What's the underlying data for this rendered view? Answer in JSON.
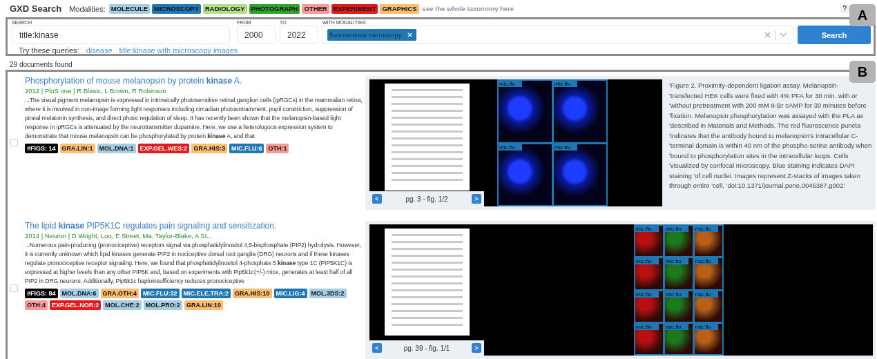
{
  "header": {
    "title": "GXD Search",
    "modalities_label": "Modalities:",
    "modalities": [
      {
        "label": "MOLECULE",
        "color": "#a6cee3"
      },
      {
        "label": "MICROSCOPY",
        "color": "#1f78b4"
      },
      {
        "label": "RADIOLOGY",
        "color": "#b2df8a"
      },
      {
        "label": "PHOTOGRAPH",
        "color": "#33a02c"
      },
      {
        "label": "OTHER",
        "color": "#fb9a99"
      },
      {
        "label": "EXPERIMENT",
        "color": "#e31a1c"
      },
      {
        "label": "GRAPHICS",
        "color": "#fdbf6f"
      }
    ],
    "taxonomy_link": "see the whole taxonomy here",
    "help": "?"
  },
  "search": {
    "search_label": "SEARCH",
    "query": "title:kinase",
    "from_label": "FROM",
    "from": "2000",
    "to_label": "TO",
    "to": "2022",
    "modalities_label": "WITH MODALITIES:",
    "chips": [
      {
        "label": "fluorescence microscopy",
        "color": "#1f78b4"
      }
    ],
    "button": "Search",
    "try_label": "Try these queries:",
    "suggestions": [
      "disease",
      "title:kinase with microscopy images"
    ]
  },
  "callouts": [
    "A",
    "B"
  ],
  "result_count": "29 documents found",
  "results": [
    {
      "title": "Phosphorylation of mouse melanopsin by protein **kinase** A.",
      "meta": "2012 | PloS one | R Blasic, L Brown, R Robinson",
      "checked": false,
      "abstract": "...The visual pigment melanopsin is expressed in intrinsically photosensitive retinal ganglion cells (ipRGCs) in the mammalian retina, where it is involved in non-image forming light responses including circadian photoentrainment, pupil constriction, suppression of pineal melatonin synthesis, and direct photic regulation of sleep. It has recently been shown that the melanopsin-based light response in ipRGCs is attenuated by the neurotransmitter dopamine. Here, we use a heterologous expression system to demonstrate that mouse melanopsin can be phosphorylated by protein **kinase** A, and that",
      "tags": [
        {
          "label": "#FIGS: 14",
          "color": "#000000"
        },
        {
          "label": "GRA.LIN:1",
          "color": "#fdbf6f"
        },
        {
          "label": "MOL.DNA:1",
          "color": "#a6cee3"
        },
        {
          "label": "EXP.GEL.WES:2",
          "color": "#e31a1c"
        },
        {
          "label": "GRA.HIS:3",
          "color": "#fdbf6f"
        },
        {
          "label": "MIC.FLU:6",
          "color": "#1f78b4"
        },
        {
          "label": "OTH:1",
          "color": "#fb9a99"
        }
      ],
      "viewer": {
        "prev": "<",
        "page": "pg. 3 - fig. 1/2",
        "next": ">"
      },
      "figure": {
        "kind": "nuclei",
        "panels": [
          "mic.flu",
          "mic.flu",
          "mic.flu",
          "mic.flu"
        ]
      },
      "caption": "'Figure 2. Proximity-dependent ligation assay. Melanopsin- 'transfected HEK cells were fixed with 4% PFA for 30 min. with or 'without pretreatment with 200 mM 8-Br cAMP for 30 minutes before 'fixation. Melanopsin phosphorylation was assayed with the PLA as 'described in Materials and Methods. The red fluorescence puncta 'indicates that the antibody bound to melanopsin's intracellular C- 'terminal domain is within 40 nm of the phospho-serine antibody when 'bound to phosphorylation sites in the intracellular loops. Cells 'visualized by confocal microscopy. Blue staining indicates DAPI staining 'of cell nuclei. Images represent Z-stacks of images taken through entire 'cell. 'doi:10.1371/journal.pone.0045387.g002'"
    },
    {
      "title": "The lipid **kinase** PIP5K1C regulates pain signaling and sensitization.",
      "meta": "2014 | Neuron | D Wright, Loo, E Street, Ma, Taylor-Blake, A St...",
      "checked": false,
      "abstract": "...Numerous pain-producing (pronociceptive) receptors signal via phosphatidylinositol 4,5-bisphosphate (PIP2) hydrolysis. However, it is currently unknown which lipid kinases generate PIP2 in nociceptive dorsal root ganglia (DRG) neurons and if these kinases regulate pronociceptive receptor signaling. Here, we found that phosphatidylinositol 4-phosphate 5 **kinase** type 1C (PIP5K1C) is expressed at higher levels than any other PIP5K and, based on experiments with Pip5k1c(+/-) mice, generates at least half of all PIP2 in DRG neurons. Additionally, Pip5k1c haploinsufficiency reduces pronociceptive",
      "tags": [
        {
          "label": "#FIGS: 84",
          "color": "#000000"
        },
        {
          "label": "MOL.DNA:6",
          "color": "#a6cee3"
        },
        {
          "label": "GRA.OTH:4",
          "color": "#fdbf6f"
        },
        {
          "label": "MIC.FLU:32",
          "color": "#1f78b4"
        },
        {
          "label": "MIC.ELE.TRA:2",
          "color": "#1f78b4"
        },
        {
          "label": "GRA.HIS:10",
          "color": "#fdbf6f"
        },
        {
          "label": "MIC.LIG:4",
          "color": "#1f78b4"
        },
        {
          "label": "MOL.3DS:2",
          "color": "#a6cee3"
        },
        {
          "label": "OTH:4",
          "color": "#fb9a99"
        },
        {
          "label": "EXP.GEL.NOR:2",
          "color": "#e31a1c"
        },
        {
          "label": "MOL.CHE:2",
          "color": "#a6cee3"
        },
        {
          "label": "MOL.PRO:2",
          "color": "#a6cee3"
        },
        {
          "label": "GRA.LIN:10",
          "color": "#fdbf6f"
        }
      ],
      "viewer": {
        "prev": "<",
        "page": "pg. 39 - fig. 1/1",
        "next": ">"
      },
      "figure": {
        "kind": "tissue",
        "panels": [
          "mic.flu",
          "mic.flu",
          "mic.flu",
          "mic.flu",
          "mic.flu",
          "mic.flu",
          "mic.flu",
          "mic.flu",
          "mic.flu",
          "mic.flu",
          "mic.flu",
          "mic.flu"
        ]
      }
    }
  ]
}
